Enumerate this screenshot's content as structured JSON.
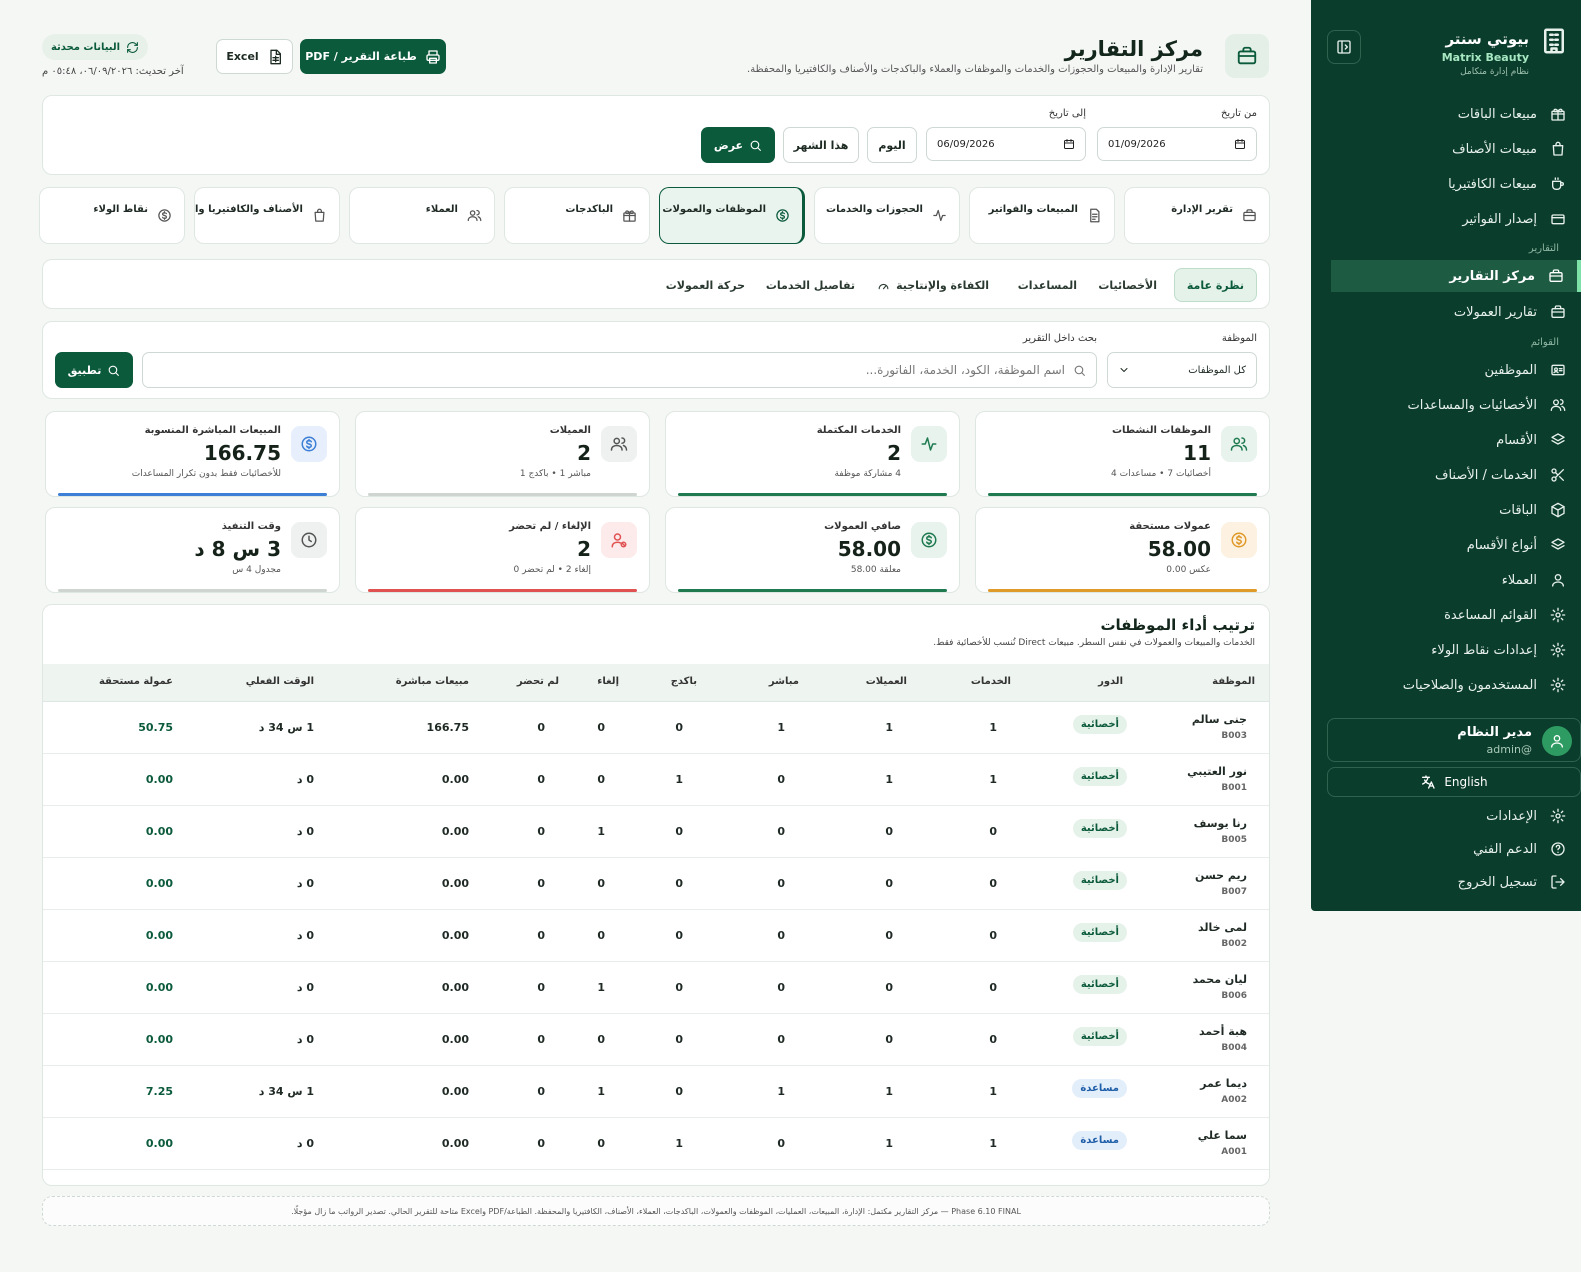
{
  "sidebar": {
    "brand_name": "بيوتي سنتر",
    "brand_sub": "Matrix Beauty",
    "brand_tag": "نظام إدارة متكامل",
    "items": [
      {
        "label": "مبيعات الباقات",
        "icon": "gift-icon"
      },
      {
        "label": "مبيعات الأصناف",
        "icon": "bag-icon"
      },
      {
        "label": "مبيعات الكافتيريا",
        "icon": "cup-icon"
      },
      {
        "label": "إصدار الفواتير",
        "icon": "card-icon"
      },
      {
        "label": "مركز التقارير",
        "icon": "briefcase-icon",
        "active": true
      },
      {
        "label": "تقارير العمولات",
        "icon": "briefcase-icon"
      },
      {
        "label": "الموظفين",
        "icon": "id-card-icon"
      },
      {
        "label": "الأخصائيات والمساعدات",
        "icon": "users-icon"
      },
      {
        "label": "الأقسام",
        "icon": "layers-icon"
      },
      {
        "label": "الخدمات / الأصناف",
        "icon": "scissors-icon"
      },
      {
        "label": "الباقات",
        "icon": "box-icon"
      },
      {
        "label": "أنواع الأقسام",
        "icon": "layers-icon"
      },
      {
        "label": "العملاء",
        "icon": "user-icon"
      },
      {
        "label": "القوائم المساعدة",
        "icon": "gear-icon"
      },
      {
        "label": "إعدادات نقاط الولاء",
        "icon": "gear-icon"
      },
      {
        "label": "المستخدمون والصلاحيات",
        "icon": "gear-icon"
      }
    ],
    "section_reports": "التقارير",
    "section_lists": "القوائم",
    "admin_name": "مدير النظام",
    "admin_user": "@admin",
    "lang_label": "English",
    "bottom": [
      {
        "label": "الإعدادات",
        "icon": "gear-icon"
      },
      {
        "label": "الدعم الفني",
        "icon": "help-icon"
      },
      {
        "label": "تسجيل الخروج",
        "icon": "logout-icon"
      }
    ]
  },
  "header": {
    "title": "مركز التقارير",
    "subtitle": "تقارير الإدارة والمبيعات والحجوزات والخدمات والموظفات والعملاء والباكدجات والأصناف والكافتيريا والمحفظة.",
    "print_label": "طباعة التقرير / PDF",
    "excel_label": "Excel",
    "updated_label": "البيانات محدثة",
    "updated_time": "آخر تحديث: ٠٦/٠٩/٢٠٢٦، ٠٥:٤٨ م"
  },
  "filters": {
    "from_label": "من تاريخ",
    "from_value": "01/09/2026",
    "to_label": "إلى تاريخ",
    "to_value": "06/09/2026",
    "today_label": "اليوم",
    "month_label": "هذا الشهر",
    "show_label": "عرض"
  },
  "report_tabs": [
    {
      "label": "تقرير الإدارة",
      "icon": "briefcase-icon"
    },
    {
      "label": "المبيعات والفواتير",
      "icon": "receipt-icon"
    },
    {
      "label": "الحجوزات والخدمات",
      "icon": "activity-icon"
    },
    {
      "label": "الموظفات والعمولات",
      "icon": "dollar-icon",
      "active": true
    },
    {
      "label": "الباكدجات",
      "icon": "gift-icon"
    },
    {
      "label": "العملاء",
      "icon": "users-icon"
    },
    {
      "label": "الأصناف والكافتيريا والمحفظة",
      "icon": "bag-icon"
    },
    {
      "label": "نقاط الولاء",
      "icon": "dollar-icon"
    }
  ],
  "sub_tabs": [
    {
      "label": "نظرة عامة",
      "active": true
    },
    {
      "label": "الأخصائيات"
    },
    {
      "label": "المساعدات"
    },
    {
      "label": "الكفاءة والإنتاجية"
    },
    {
      "label": "تفاصيل الخدمات"
    },
    {
      "label": "حركة العمولات"
    }
  ],
  "search": {
    "employee_label": "الموظفة",
    "employee_value": "كل الموظفات",
    "search_label": "بحث داخل التقرير",
    "placeholder": "اسم الموظفة، الكود، الخدمة، الفاتورة...",
    "apply_label": "تطبيق"
  },
  "kpis": [
    {
      "label": "الموظفات النشطات",
      "value": "11",
      "sub": "أخصائيات 7 • مساعدات 4",
      "icon": "users-icon",
      "color": "#1f7a50",
      "bg": "#e7f3ec"
    },
    {
      "label": "الخدمات المكتملة",
      "value": "2",
      "sub": "4 مشاركة موظفة",
      "icon": "activity-icon",
      "color": "#1f7a50",
      "bg": "#e7f3ec"
    },
    {
      "label": "العميلات",
      "value": "2",
      "sub": "مباشر 1 • باكدج 1",
      "icon": "users-icon",
      "color": "#cfd6d2",
      "bg": "#eef1ef"
    },
    {
      "label": "المبيعات المباشرة المنسوبة",
      "value": "166.75",
      "sub": "للأخصائيات فقط بدون تكرار المساعدات",
      "icon": "dollar-icon",
      "color": "#3d7fd6",
      "bg": "#e6effb"
    },
    {
      "label": "عمولات مستحقة",
      "value": "58.00",
      "sub": "عكس 0.00",
      "icon": "dollar-icon",
      "color": "#e09a2a",
      "bg": "#fdf1e2"
    },
    {
      "label": "صافي العمولات",
      "value": "58.00",
      "sub": "معلقة 58.00",
      "icon": "dollar-icon",
      "color": "#1f7a50",
      "bg": "#e7f3ec"
    },
    {
      "label": "الإلغاء / لم تحضر",
      "value": "2",
      "sub": "إلغاء 2 • لم تحضر 0",
      "icon": "user-x-icon",
      "color": "#e05252",
      "bg": "#fdeaea"
    },
    {
      "label": "وقت التنفيذ",
      "value": "3 س 8 د",
      "sub": "مجدول 4 س",
      "icon": "clock-icon",
      "color": "#cfd6d2",
      "bg": "#eef1ef"
    }
  ],
  "table": {
    "title": "ترتيب أداء الموظفات",
    "subtitle": "الخدمات والمبيعات والعمولات في نفس السطر. مبيعات Direct تُنسب للأخصائية فقط.",
    "headers": [
      "الموظفة",
      "الدور",
      "الخدمات",
      "العميلات",
      "مباشر",
      "باكدج",
      "إلغاء",
      "لم تحضر",
      "مبيعات مباشرة",
      "الوقت الفعلي",
      "عمولة مستحقة"
    ],
    "rows": [
      {
        "name": "جنى سالم",
        "code": "B003",
        "role": "أخصائية",
        "role_type": "spec",
        "services": "1",
        "clients": "1",
        "direct": "1",
        "package": "0",
        "cancel": "0",
        "noshow": "0",
        "sales": "166.75",
        "time": "1 س 34 د",
        "commission": "50.75"
      },
      {
        "name": "نور العتيبي",
        "code": "B001",
        "role": "أخصائية",
        "role_type": "spec",
        "services": "1",
        "clients": "1",
        "direct": "0",
        "package": "1",
        "cancel": "0",
        "noshow": "0",
        "sales": "0.00",
        "time": "0 د",
        "commission": "0.00"
      },
      {
        "name": "رنا يوسف",
        "code": "B005",
        "role": "أخصائية",
        "role_type": "spec",
        "services": "0",
        "clients": "0",
        "direct": "0",
        "package": "0",
        "cancel": "1",
        "noshow": "0",
        "sales": "0.00",
        "time": "0 د",
        "commission": "0.00"
      },
      {
        "name": "ريم حسن",
        "code": "B007",
        "role": "أخصائية",
        "role_type": "spec",
        "services": "0",
        "clients": "0",
        "direct": "0",
        "package": "0",
        "cancel": "0",
        "noshow": "0",
        "sales": "0.00",
        "time": "0 د",
        "commission": "0.00"
      },
      {
        "name": "لمى خالد",
        "code": "B002",
        "role": "أخصائية",
        "role_type": "spec",
        "services": "0",
        "clients": "0",
        "direct": "0",
        "package": "0",
        "cancel": "0",
        "noshow": "0",
        "sales": "0.00",
        "time": "0 د",
        "commission": "0.00"
      },
      {
        "name": "ليان محمد",
        "code": "B006",
        "role": "أخصائية",
        "role_type": "spec",
        "services": "0",
        "clients": "0",
        "direct": "0",
        "package": "0",
        "cancel": "1",
        "noshow": "0",
        "sales": "0.00",
        "time": "0 د",
        "commission": "0.00"
      },
      {
        "name": "هبة أحمد",
        "code": "B004",
        "role": "أخصائية",
        "role_type": "spec",
        "services": "0",
        "clients": "0",
        "direct": "0",
        "package": "0",
        "cancel": "0",
        "noshow": "0",
        "sales": "0.00",
        "time": "0 د",
        "commission": "0.00"
      },
      {
        "name": "ديما عمر",
        "code": "A002",
        "role": "مساعدة",
        "role_type": "asst",
        "services": "1",
        "clients": "1",
        "direct": "1",
        "package": "0",
        "cancel": "1",
        "noshow": "0",
        "sales": "0.00",
        "time": "1 س 34 د",
        "commission": "7.25"
      },
      {
        "name": "سما علي",
        "code": "A001",
        "role": "مساعدة",
        "role_type": "asst",
        "services": "1",
        "clients": "1",
        "direct": "0",
        "package": "1",
        "cancel": "0",
        "noshow": "0",
        "sales": "0.00",
        "time": "0 د",
        "commission": "0.00"
      }
    ]
  },
  "footer_note": "Phase 6.10 FINAL — مركز التقارير مكتمل: الإدارة، المبيعات، العمليات، الموظفات والعمولات، الباكدجات، العملاء، الأصناف، الكافتيريا والمحفظة. الطباعة/PDF وExcel متاحة للتقرير الحالي. تصدير الرواتب ما زال مؤجلًا."
}
